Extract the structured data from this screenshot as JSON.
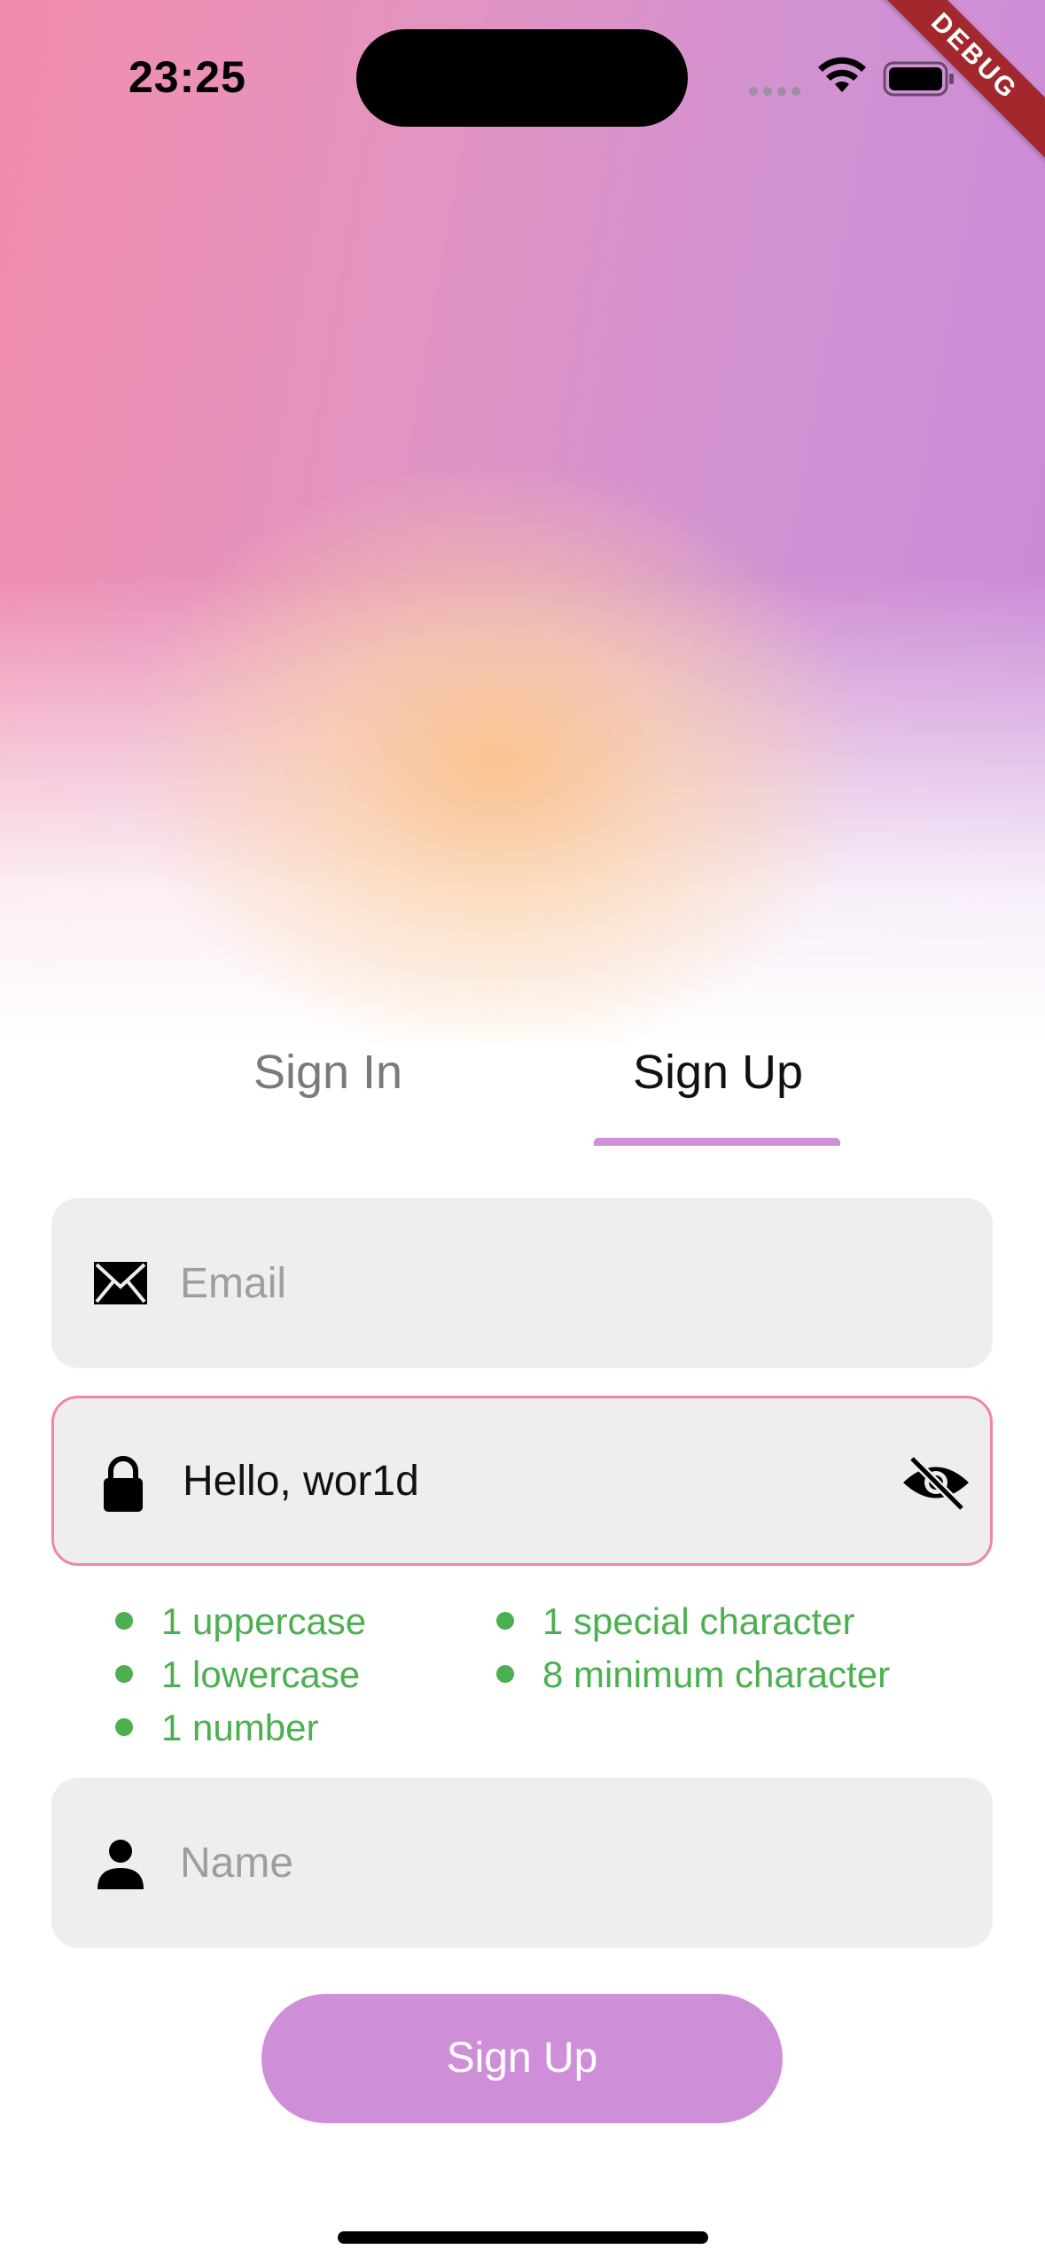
{
  "status_bar": {
    "time": "23:25",
    "debug_banner": "DEBUG"
  },
  "tabs": [
    {
      "label": "Sign In",
      "selected": false
    },
    {
      "label": "Sign Up",
      "selected": true
    }
  ],
  "form": {
    "email": {
      "placeholder": "Email",
      "value": "",
      "icon": "envelope-icon"
    },
    "password": {
      "value": "Hello, wor1d",
      "icon": "lock-icon",
      "toggle_icon": "eye-off-icon"
    },
    "password_requirements": [
      "1 uppercase",
      "1 lowercase",
      "1 number",
      "1 special character",
      "8 minimum character"
    ],
    "name": {
      "placeholder": "Name",
      "value": "",
      "icon": "person-icon"
    },
    "submit_label": "Sign Up"
  },
  "colors": {
    "accent": "#cf8fd8",
    "error_border": "#ef85ab",
    "requirement_ok": "#4caf50",
    "field_bg": "#eeeeee"
  }
}
